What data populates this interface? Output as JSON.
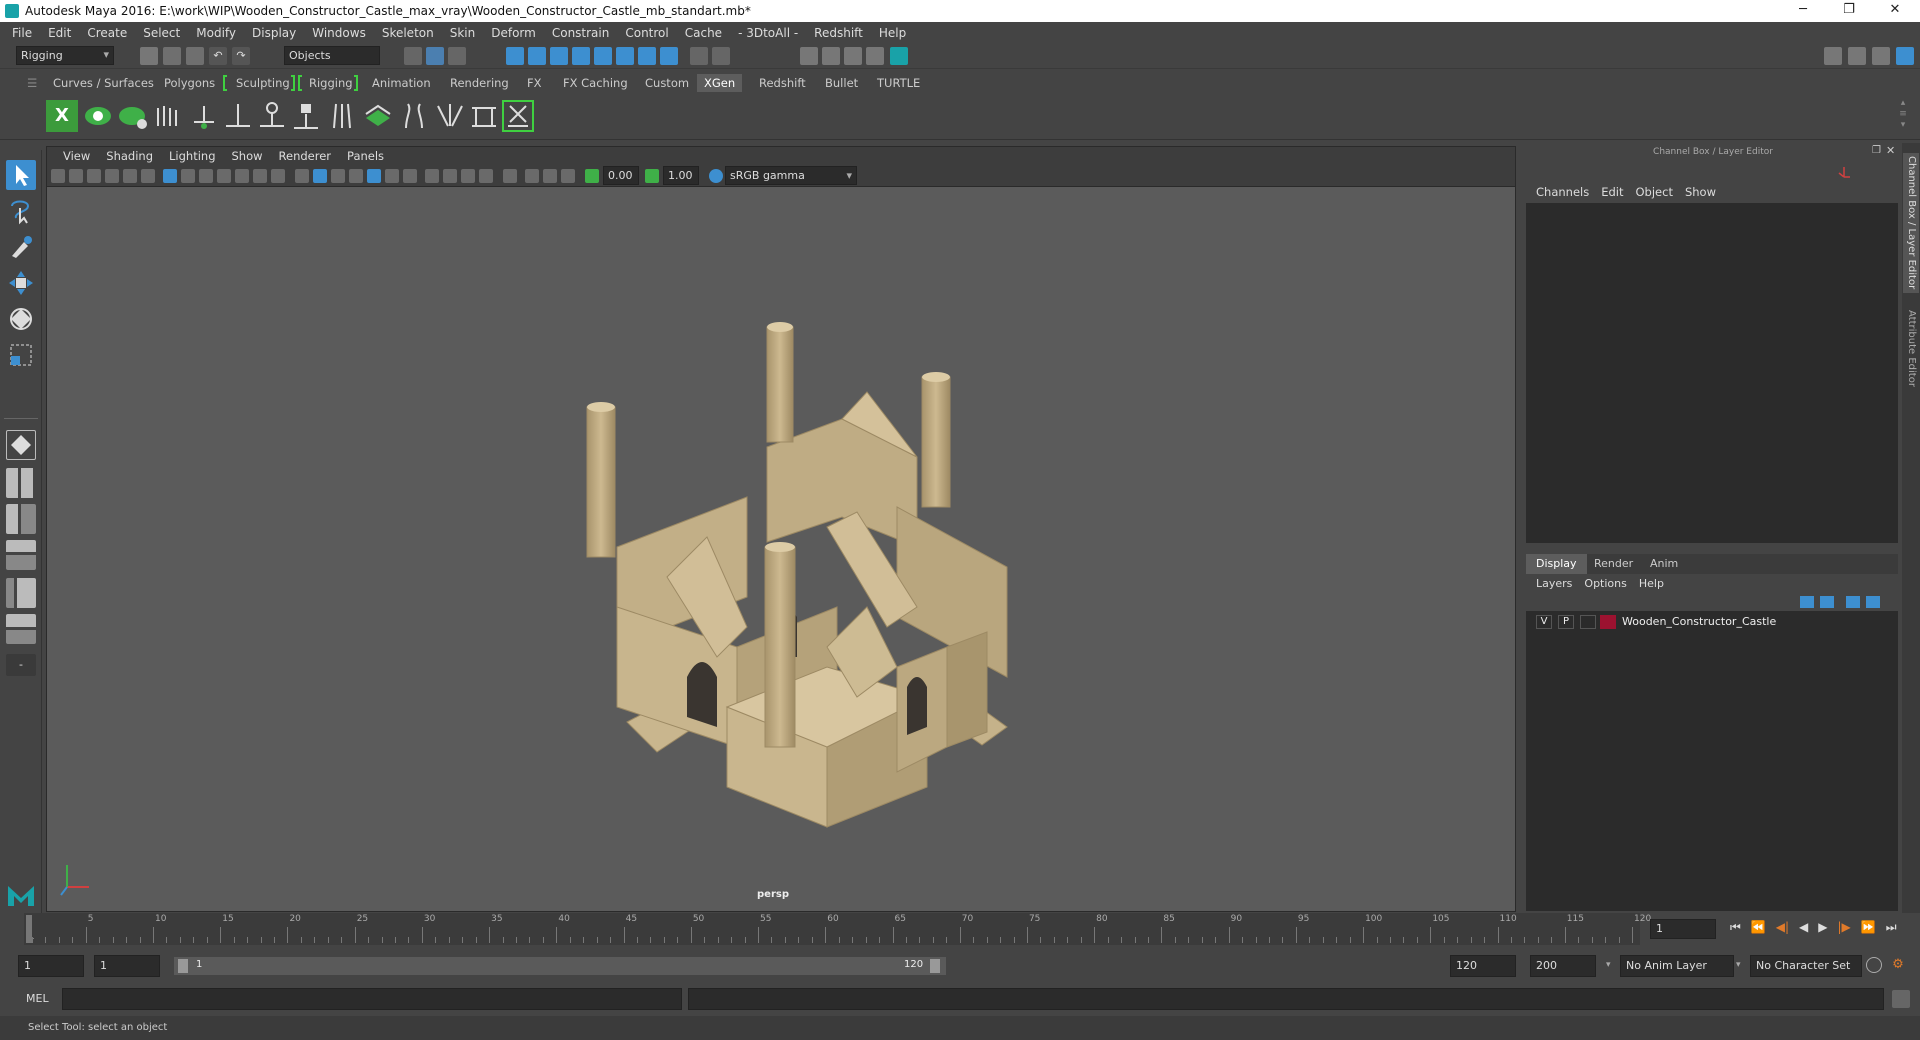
{
  "window": {
    "title": "Autodesk Maya 2016: E:\\work\\WIP\\Wooden_Constructor_Castle_max_vray\\Wooden_Constructor_Castle_mb_standart.mb*"
  },
  "menu": [
    "File",
    "Edit",
    "Create",
    "Select",
    "Modify",
    "Display",
    "Windows",
    "Skeleton",
    "Skin",
    "Deform",
    "Constrain",
    "Control",
    "Cache",
    "- 3DtoAll -",
    "Redshift",
    "Help"
  ],
  "status": {
    "mode": "Rigging",
    "objects_label": "Objects"
  },
  "shelf_tabs": [
    "Curves / Surfaces",
    "Polygons",
    "Sculpting",
    "Rigging",
    "Animation",
    "Rendering",
    "FX",
    "FX Caching",
    "Custom",
    "XGen",
    "Redshift",
    "Bullet",
    "TURTLE"
  ],
  "shelf_active": "XGen",
  "viewport": {
    "menu": [
      "View",
      "Shading",
      "Lighting",
      "Show",
      "Renderer",
      "Panels"
    ],
    "exposure": "0.00",
    "gamma": "1.00",
    "color_space": "sRGB gamma",
    "camera_label": "persp"
  },
  "channel_box": {
    "title": "Channel Box / Layer Editor",
    "menu": [
      "Channels",
      "Edit",
      "Object",
      "Show"
    ]
  },
  "layer_editor": {
    "tabs": [
      "Display",
      "Render",
      "Anim"
    ],
    "active_tab": "Display",
    "menu": [
      "Layers",
      "Options",
      "Help"
    ],
    "layers": [
      {
        "v": "V",
        "p": "P",
        "name": "Wooden_Constructor_Castle",
        "color": "#9c1230"
      }
    ]
  },
  "side_tabs": [
    "Channel Box / Layer Editor",
    "Attribute Editor"
  ],
  "timeline": {
    "ticks": [
      "5",
      "10",
      "15",
      "20",
      "25",
      "30",
      "35",
      "40",
      "45",
      "50",
      "55",
      "60",
      "65",
      "70",
      "75",
      "80",
      "85",
      "90",
      "95",
      "100",
      "105",
      "110",
      "115",
      "120"
    ],
    "start_label": "1",
    "current_frame": "1"
  },
  "range": {
    "start": "1",
    "inner_start": "1",
    "slider_start": "1",
    "slider_end": "120",
    "end": "120",
    "outer_end": "200",
    "anim_layer": "No Anim Layer",
    "char_set": "No Character Set"
  },
  "cmd": {
    "label": "MEL"
  },
  "help_text": "Select Tool: select an object",
  "colors": {
    "ui_bg": "#444444",
    "viewport_bg": "#5b5b5b",
    "wood": "#c9b68e",
    "active_green": "#3fd040",
    "accent_blue": "#3d8fd0"
  }
}
